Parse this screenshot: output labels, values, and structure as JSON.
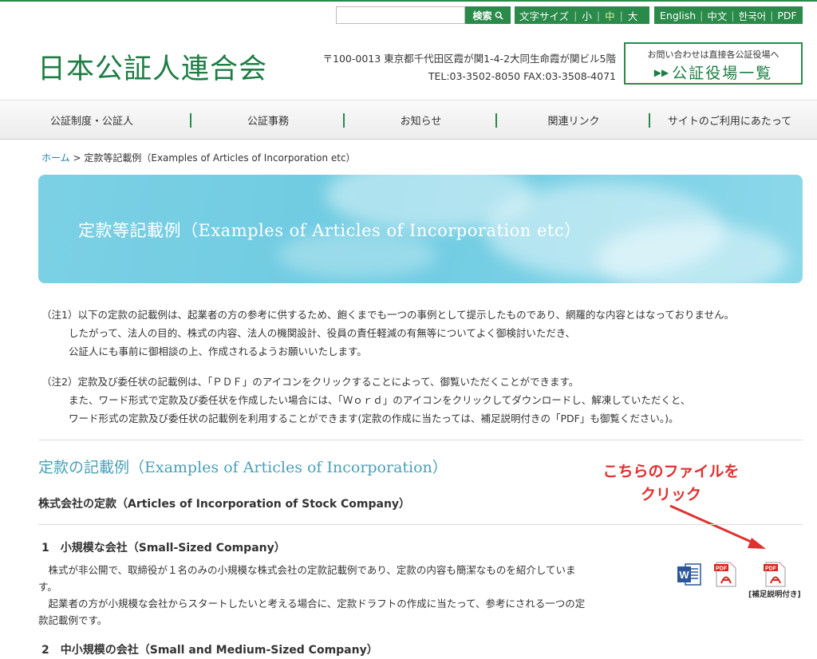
{
  "search": {
    "button_label": "検索"
  },
  "font_size": {
    "label": "文字サイズ",
    "small": "小",
    "medium": "中",
    "large": "大"
  },
  "languages": [
    "English",
    "中文",
    "한국어",
    "PDF"
  ],
  "logo": "日本公証人連合会",
  "address": {
    "line1": "〒100-0013 東京都千代田区霞が関1-4-2大同生命霞が関ビル5階",
    "line2": "TEL:03-3502-8050 FAX:03-3508-4071"
  },
  "office_box": {
    "small": "お問い合わせは直接各公証役場へ",
    "big": "公証役場一覧"
  },
  "nav": [
    "公証制度・公証人",
    "公証事務",
    "お知らせ",
    "関連リンク",
    "サイトのご利用にあたって"
  ],
  "breadcrumb": {
    "home": "ホーム",
    "separator": ">",
    "current": "定款等記載例（Examples of Articles of Incorporation etc）"
  },
  "banner": {
    "title": "定款等記載例（Examples of Articles of Incorporation etc）"
  },
  "notes": {
    "note1": [
      "（注1）以下の定款の記載例は、起業者の方の参考に供するため、飽くまでも一つの事例として提示したものであり、網羅的な内容とはなっておりません。",
      "したがって、法人の目的、株式の内容、法人の機関設計、役員の責任軽減の有無等についてよく御検討いただき、",
      "公証人にも事前に御相談の上、作成されるようお願いいたします。"
    ],
    "note2": [
      "（注2）定款及び委任状の記載例は、「ＰＤＦ」のアイコンをクリックすることによって、御覧いただくことができます。",
      "また、ワード形式で定款及び委任状を作成したい場合には、「Ｗｏｒｄ」のアイコンをクリックしてダウンロードし、解凍していただくと、",
      "ワード形式の定款及び委任状の記載例を利用することができます(定款の作成に当たっては、補足説明付きの「PDF」も御覧ください。)。"
    ]
  },
  "section": {
    "title": "定款の記載例（Examples of Articles of Incorporation）",
    "stock_title": "株式会社の定款（Articles of Incorporation of Stock Company）"
  },
  "annotation": {
    "line1": "こちらのファイルを",
    "line2": "クリック"
  },
  "items": [
    {
      "title": "1　小規模な会社（Small-Sized Company）",
      "desc1": "　株式が非公開で、取締役が１名のみの小規模な株式会社の定款記載例であり、定款の内容も簡潔なものを紹介していま",
      "desc1b": "す。",
      "desc2": "　起業者の方が小規模な会社からスタートしたいと考える場合に、定款ドラフトの作成に当たって、参考にされる一つの定",
      "desc2b": "款記載例です。"
    },
    {
      "title": "2　中小規模の会社（Small and Medium-Sized Company）"
    }
  ],
  "icons": {
    "pdf_text": "PDF",
    "pdf_supplement_label": "[補足説明付き]"
  },
  "colors": {
    "brand_green": "#2a8a4a",
    "annotation_red": "#e0302f",
    "section_teal": "#4aa0b6"
  }
}
